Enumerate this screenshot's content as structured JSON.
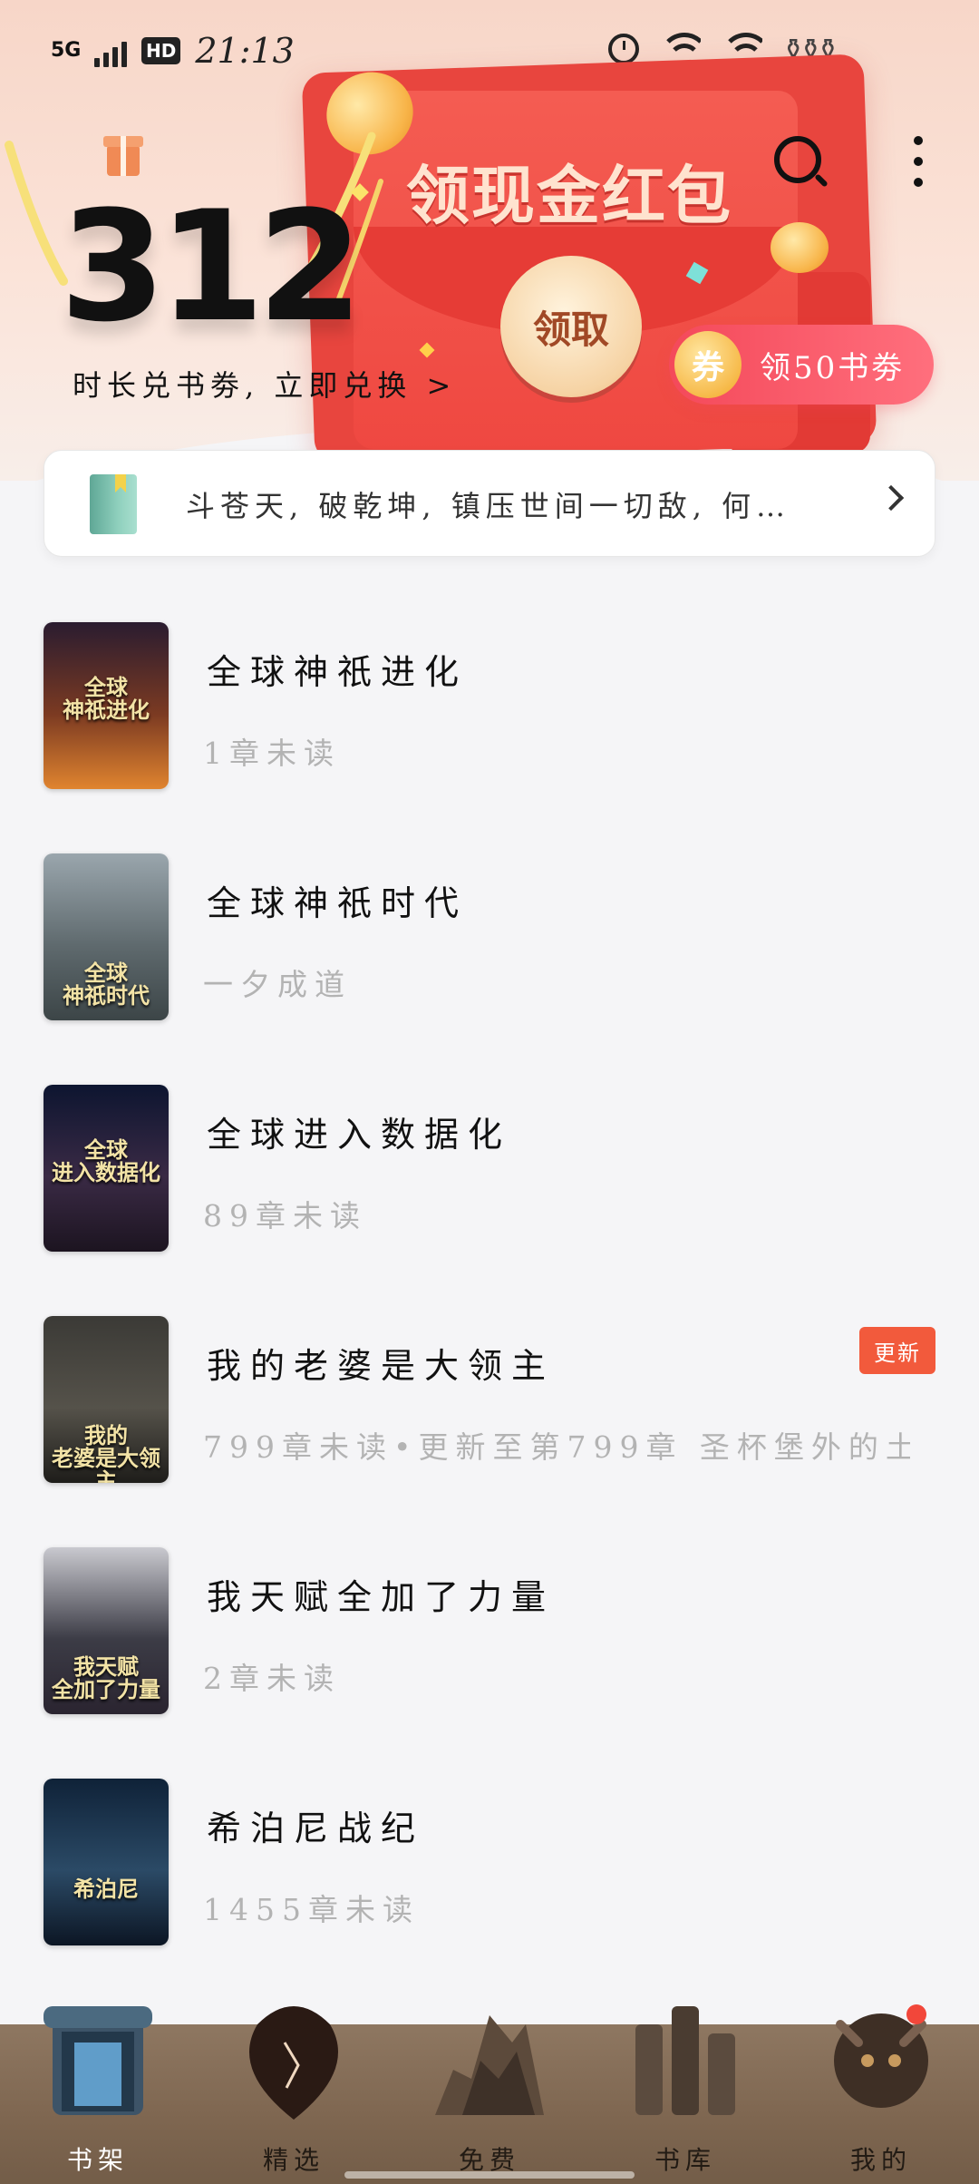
{
  "status_bar": {
    "network": "5G",
    "hd": "HD",
    "time": "21:13"
  },
  "header": {
    "streak_number": "312",
    "exchange_link": "时长兑书劵, 立即兑换 >",
    "banner_title": "领现金红包",
    "claim_button": "领取",
    "coupon_icon_text": "券",
    "coupon_text": "领50书劵"
  },
  "notice": {
    "text": "斗苍天, 破乾坤, 镇压世间一切敌, 何…"
  },
  "books": [
    {
      "title": "全球神祇进化",
      "sub": "1章未读",
      "cover_text": "全球\n神祇进化",
      "cover_colors": [
        "#2a1c30",
        "#7b3a22",
        "#e0842f"
      ]
    },
    {
      "title": "全球神祇时代",
      "sub": "一夕成道",
      "cover_text": "全球\n神祇时代",
      "cover_colors": [
        "#9aa6ad",
        "#5f6a6e",
        "#3c4547"
      ]
    },
    {
      "title": "全球进入数据化",
      "sub": "89章未读",
      "cover_text": "全球\n进入数据化",
      "cover_colors": [
        "#0d1530",
        "#3a2a45",
        "#1c1420"
      ]
    },
    {
      "title": "我的老婆是大领主",
      "sub": "799章未读•更新至第799章 圣杯堡外的土…",
      "badge": "更新",
      "cover_text": "我的\n老婆是大领主",
      "cover_colors": [
        "#3b3a36",
        "#55524a",
        "#1e1d1a"
      ]
    },
    {
      "title": "我天赋全加了力量",
      "sub": "2章未读",
      "cover_text": "我天赋\n全加了力量",
      "cover_colors": [
        "#c9c9cf",
        "#3c3c46",
        "#2a2430"
      ]
    },
    {
      "title": "希泊尼战纪",
      "sub": "1455章未读",
      "cover_text": "希泊尼",
      "cover_colors": [
        "#0f2238",
        "#2b4a66",
        "#0c1624"
      ]
    }
  ],
  "nav": [
    {
      "label": "书架",
      "active": true
    },
    {
      "label": "精选",
      "active": false
    },
    {
      "label": "免费",
      "active": false
    },
    {
      "label": "书库",
      "active": false
    },
    {
      "label": "我的",
      "active": false
    }
  ],
  "colors": {
    "accent_red": "#f2473a",
    "coupon_pink": "#f4495a",
    "nav_brown": "#7e6650"
  }
}
